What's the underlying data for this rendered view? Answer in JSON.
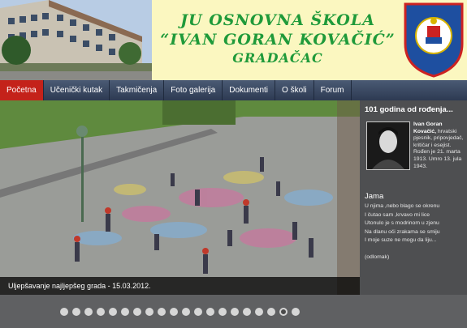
{
  "header": {
    "title_line1": "JU OSNOVNA ŠKOLA",
    "title_line2": "“IVAN GORAN KOVAČIĆ”",
    "title_line3": "GRADAČAC",
    "title_color": "#1f9a3a",
    "crest_name": "school-crest"
  },
  "nav": {
    "items": [
      {
        "label": "Početna",
        "active": true
      },
      {
        "label": "Učenički kutak",
        "active": false
      },
      {
        "label": "Takmičenja",
        "active": false
      },
      {
        "label": "Foto galerija",
        "active": false
      },
      {
        "label": "Dokumenti",
        "active": false
      },
      {
        "label": "O školi",
        "active": false
      },
      {
        "label": "Forum",
        "active": false
      }
    ],
    "active_color": "#c4221a"
  },
  "slider": {
    "caption": "Uljepšavanje najljepšeg grada - 15.03.2012.",
    "dot_count": 20,
    "active_dot": 18
  },
  "sidebar": {
    "title": "101 godina od rođenja...",
    "bio_name": "Ivan Goran Kovačić,",
    "bio_text": "hrvatski pjesnik, pripovjedač, kritičar i esejist. Rođen je 21. marta 1913. Umro 13. jula 1943.",
    "poem_title": "Jama",
    "poem_lines": [
      "U njima ,nebo blago se okrenu",
      "I čutao sam ,krvavo mi lice",
      "Utonulo je s modrinom u zjenu",
      "Na dlanu oči zrakama se smiju",
      "I moje suze ne mogu da liju..."
    ],
    "excerpt_note": "(odlomak)"
  }
}
